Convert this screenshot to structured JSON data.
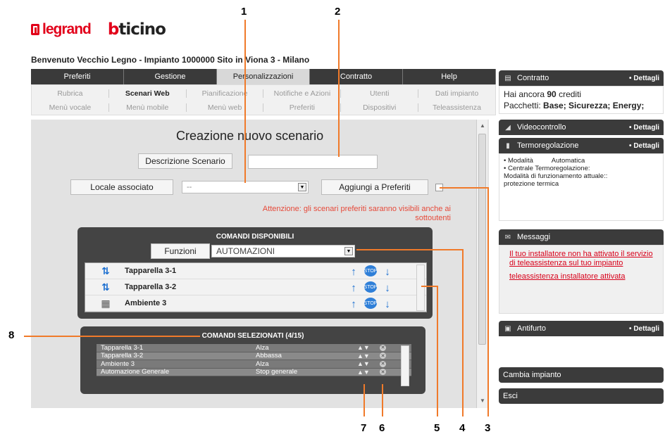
{
  "brand": {
    "legrand": "legrand",
    "bticino_b": "b",
    "bticino_rest": "ticino"
  },
  "welcome": "Benvenuto Vecchio Legno - Impianto 1000000 Sito in Viona 3 - Milano",
  "tabs": [
    {
      "label": "Preferiti"
    },
    {
      "label": "Gestione"
    },
    {
      "label": "Personalizzazioni"
    },
    {
      "label": "Contratto"
    },
    {
      "label": "Help"
    }
  ],
  "subnav": {
    "row1": [
      "Rubrica",
      "Scenari Web",
      "Pianificazione",
      "Notifiche e Azioni",
      "Utenti",
      "Dati impianto"
    ],
    "row2": [
      "Menù vocale",
      "Menù mobile",
      "Menù web",
      "Preferiti",
      "Dispositivi",
      "Teleassistenza"
    ]
  },
  "form": {
    "title": "Creazione nuovo scenario",
    "descrizione_btn": "Descrizione Scenario",
    "descrizione_value": "",
    "locale_btn": "Locale associato",
    "locale_value": "--",
    "aggiungi_btn": "Aggiungi a Preferiti",
    "warning": "Attenzione: gli scenari preferiti saranno visibili anche ai sottoutenti"
  },
  "available": {
    "title": "COMANDI DISPONIBILI",
    "funzioni_btn": "Funzioni",
    "funzioni_value": "AUTOMAZIONI",
    "items": [
      {
        "name": "Tapparella 3-1"
      },
      {
        "name": "Tapparella 3-2"
      },
      {
        "name": "Ambiente 3"
      }
    ],
    "stop_label": "STOP"
  },
  "selected": {
    "title": "COMANDI SELEZIONATI (4/15)",
    "rows": [
      {
        "name": "Tapparella 3-1",
        "action": "Alza"
      },
      {
        "name": "Tapparella 3-2",
        "action": "Abbassa"
      },
      {
        "name": "Ambiente 3",
        "action": "Alza"
      },
      {
        "name": "Automazione Generale",
        "action": "Stop generale"
      }
    ]
  },
  "callouts": [
    "1",
    "2",
    "3",
    "4",
    "5",
    "6",
    "7",
    "8"
  ],
  "sidebar": {
    "contratto": {
      "title": "Contratto",
      "details": "• Dettagli",
      "credits_prefix": "Hai ancora ",
      "credits": "90",
      "credits_suffix": " crediti",
      "packages_prefix": "Pacchetti: ",
      "packages": "Base; Sicurezza; Energy;"
    },
    "video": {
      "title": "Videocontrollo",
      "details": "• Dettagli"
    },
    "termo": {
      "title": "Termoregolazione",
      "details": "• Dettagli",
      "lines": [
        "• Modalità          Automatica",
        "• Centrale Termoregolazione:",
        "Modalità di funzionamento attuale::",
        "protezione termica"
      ]
    },
    "messaggi": {
      "title": "Messaggi",
      "msg1": "Il tuo installatore non ha attivato il servizio di teleassistenza sul tuo impianto",
      "msg2": "teleassistenza installatore attivata"
    },
    "antifurto": {
      "title": "Antifurto",
      "details": "• Dettagli"
    },
    "cambia": "Cambia impianto",
    "esci": "Esci"
  },
  "colors": {
    "accent_orange": "#f07a2a",
    "alert_red": "#d8001a",
    "dark_bar": "#3b3b3b"
  }
}
